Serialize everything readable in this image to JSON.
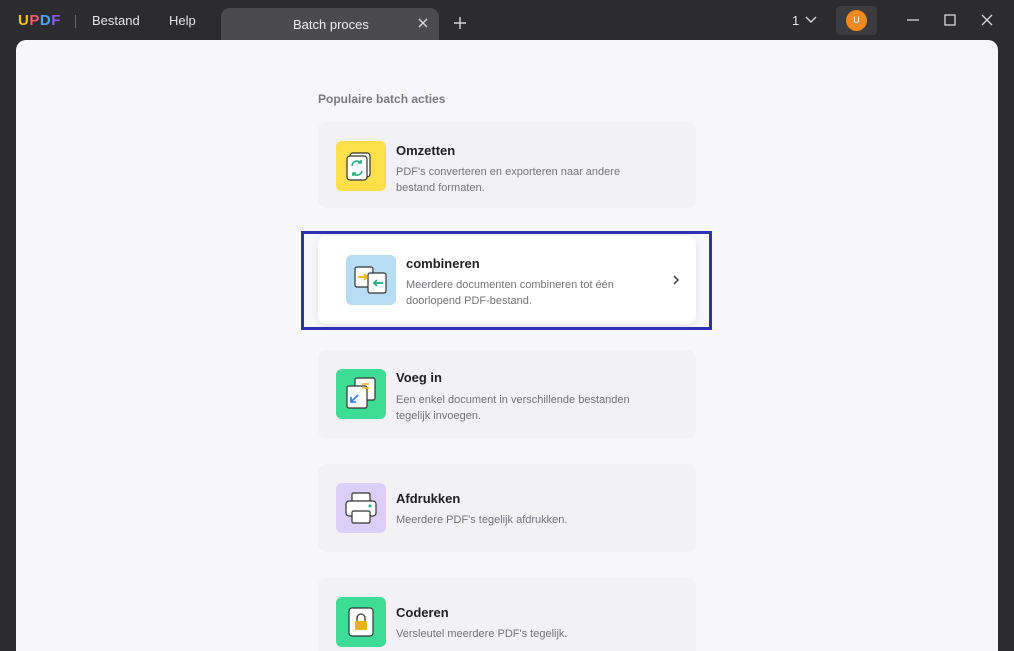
{
  "app": {
    "logo": {
      "u": "U",
      "p": "P",
      "d": "D",
      "f": "F"
    },
    "menu": [
      "Bestand",
      "Help"
    ]
  },
  "tab": {
    "label": "Batch proces",
    "close_icon": "close-icon"
  },
  "toolbar": {
    "page_count": "1",
    "avatar_initial": "U"
  },
  "main": {
    "section_title": "Populaire batch acties",
    "actions": [
      {
        "title": "Omzetten",
        "description_line1": "PDF's converteren en exporteren naar andere",
        "description_line2": "bestand formaten.",
        "icon": "convert-icon",
        "icon_bg": "#fde047"
      },
      {
        "title": "combineren",
        "description_line1": "Meerdere documenten combineren tot één",
        "description_line2": "doorlopend PDF-bestand.",
        "icon": "combine-icon",
        "icon_bg": "#b7ddf5"
      },
      {
        "title": "Voeg in",
        "description_line1": "Een enkel document in verschillende bestanden",
        "description_line2": "tegelijk invoegen.",
        "icon": "insert-icon",
        "icon_bg": "#3ddc97"
      },
      {
        "title": "Afdrukken",
        "description_line1": "Meerdere PDF's tegelijk afdrukken.",
        "description_line2": "",
        "icon": "print-icon",
        "icon_bg": "#dccff7"
      },
      {
        "title": "Coderen",
        "description_line1": "Versleutel meerdere PDF's tegelijk.",
        "description_line2": "",
        "icon": "encrypt-icon",
        "icon_bg": "#3ddc97"
      }
    ]
  },
  "colors": {
    "titlebar_bg": "#2c2c2f",
    "content_bg": "#f7f7f9",
    "highlight_border": "#2b32b2",
    "avatar_bg": "#f08a1c"
  }
}
